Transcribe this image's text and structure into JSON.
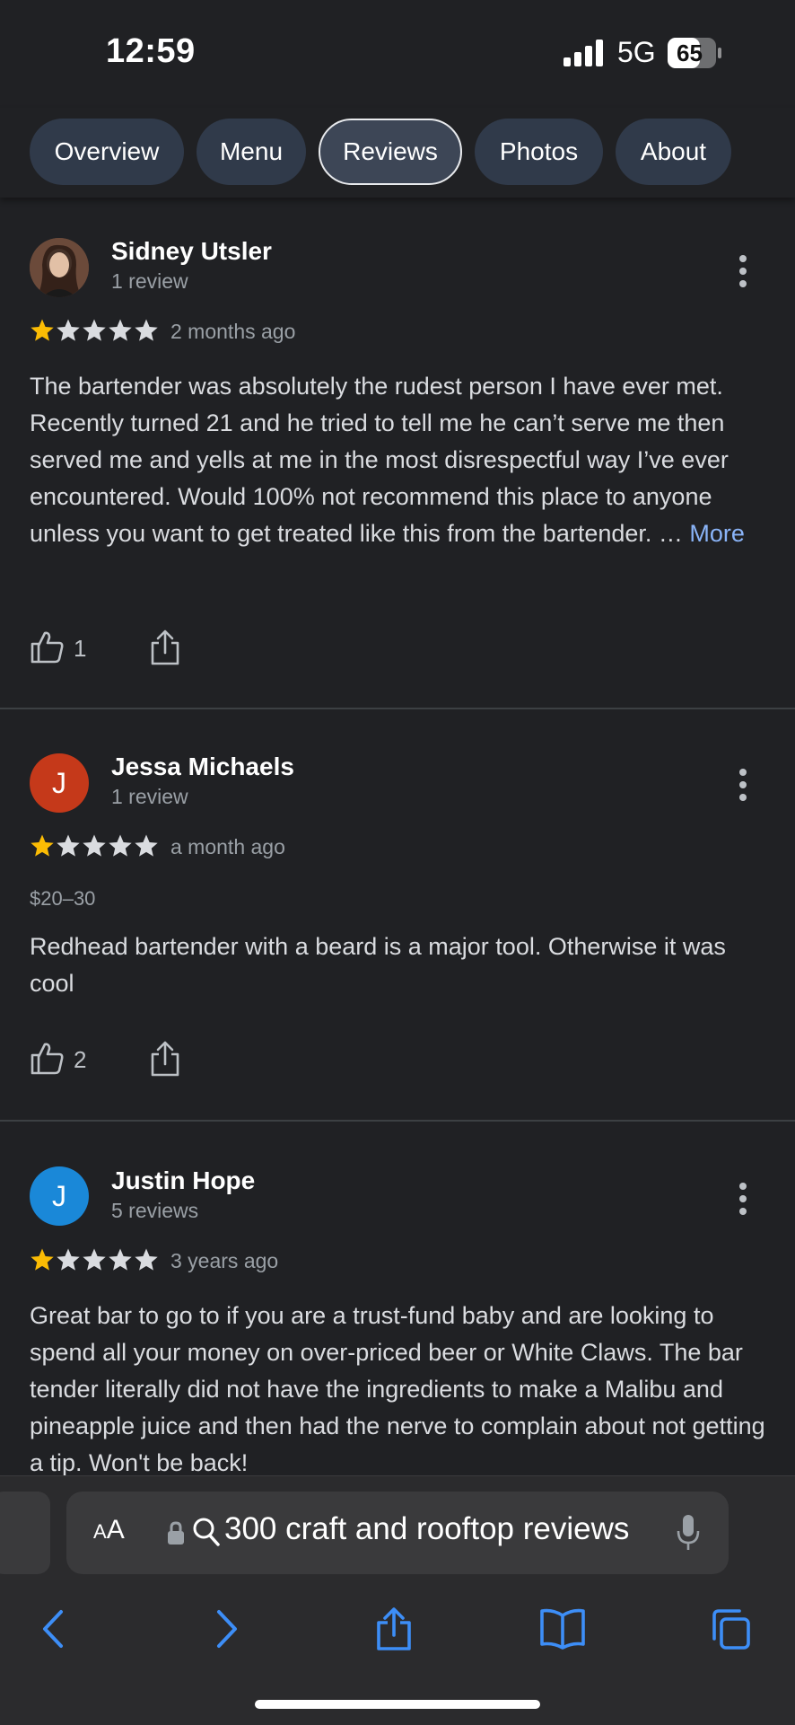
{
  "status_bar": {
    "time": "12:59",
    "network": "5G",
    "battery": "65"
  },
  "tabs": [
    {
      "label": "Overview",
      "active": false
    },
    {
      "label": "Menu",
      "active": false
    },
    {
      "label": "Reviews",
      "active": true
    },
    {
      "label": "Photos",
      "active": false
    },
    {
      "label": "About",
      "active": false
    }
  ],
  "reviews": [
    {
      "name": "Sidney Utsler",
      "count": "1 review",
      "rating": 1,
      "when": "2 months ago",
      "price": "",
      "text": "The bartender was absolutely the rudest person I have ever met. Recently turned 21 and he tried to tell me he can’t serve me then served me and yells at me in the most disrespectful way I’ve ever encountered. Would 100% not recommend this place to anyone unless you want to get treated like this from the bartender. … ",
      "more": "More",
      "likes": "1",
      "avatar": "photo"
    },
    {
      "name": "Jessa Michaels",
      "count": "1 review",
      "rating": 1,
      "when": "a month ago",
      "price": "$20–30",
      "text": "Redhead bartender with a beard is a major tool. Otherwise it was cool",
      "likes": "2",
      "avatar_letter": "J",
      "avatar_color": "#c5391a"
    },
    {
      "name": "Justin Hope",
      "count": "5 reviews",
      "rating": 1,
      "when": "3 years ago",
      "text": "Great bar to go to if you are a trust-fund baby and are looking to spend all your money on over-priced beer or White Claws. The bar tender literally did not have the ingredients to make a Malibu and pineapple juice and then had the nerve to complain about not getting a tip. Won't be back!",
      "avatar_letter": "J",
      "avatar_color": "#1a88d8"
    }
  ],
  "browser": {
    "text_size_label_small": "A",
    "text_size_label_large": "A",
    "url_text": "300 craft and rooftop reviews"
  },
  "colors": {
    "star_filled": "#fbbc04",
    "star_empty": "#dadce0",
    "link": "#8ab4f8"
  }
}
